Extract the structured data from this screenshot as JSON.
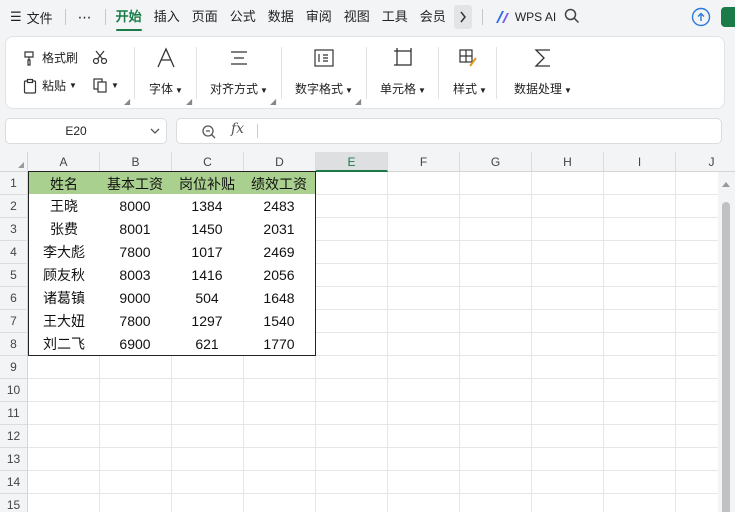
{
  "menubar": {
    "file_label": "文件",
    "more_label": "⋯",
    "tabs": [
      {
        "label": "开始",
        "active": true
      },
      {
        "label": "插入",
        "active": false
      },
      {
        "label": "页面",
        "active": false
      },
      {
        "label": "公式",
        "active": false
      },
      {
        "label": "数据",
        "active": false
      },
      {
        "label": "审阅",
        "active": false
      },
      {
        "label": "视图",
        "active": false
      },
      {
        "label": "工具",
        "active": false
      },
      {
        "label": "会员",
        "active": false
      }
    ],
    "wps_ai_label": "WPS AI"
  },
  "ribbon": {
    "format_painter": "格式刷",
    "paste": "粘贴",
    "font": "字体",
    "align": "对齐方式",
    "number_format": "数字格式",
    "cell": "单元格",
    "style": "样式",
    "data_processing": "数据处理"
  },
  "namebox": {
    "value": "E20"
  },
  "formula": {
    "fx": "fx",
    "value": ""
  },
  "columns": [
    "A",
    "B",
    "C",
    "D",
    "E",
    "F",
    "G",
    "H",
    "I",
    "J"
  ],
  "selected_column": "E",
  "rows": [
    "1",
    "2",
    "3",
    "4",
    "5",
    "6",
    "7",
    "8",
    "9",
    "10",
    "11",
    "12",
    "13",
    "14",
    "15"
  ],
  "table": {
    "headers": [
      "姓名",
      "基本工资",
      "岗位补贴",
      "绩效工资"
    ],
    "rows": [
      [
        "王晓",
        "8000",
        "1384",
        "2483"
      ],
      [
        "张费",
        "8001",
        "1450",
        "2031"
      ],
      [
        "李大彪",
        "7800",
        "1017",
        "2469"
      ],
      [
        "顾友秋",
        "8003",
        "1416",
        "2056"
      ],
      [
        "诸葛镇",
        "9000",
        "504",
        "1648"
      ],
      [
        "王大妞",
        "7800",
        "1297",
        "1540"
      ],
      [
        "刘二飞",
        "6900",
        "621",
        "1770"
      ]
    ],
    "header_color": "#a9d08e"
  },
  "accent_color": "#1a7b48"
}
